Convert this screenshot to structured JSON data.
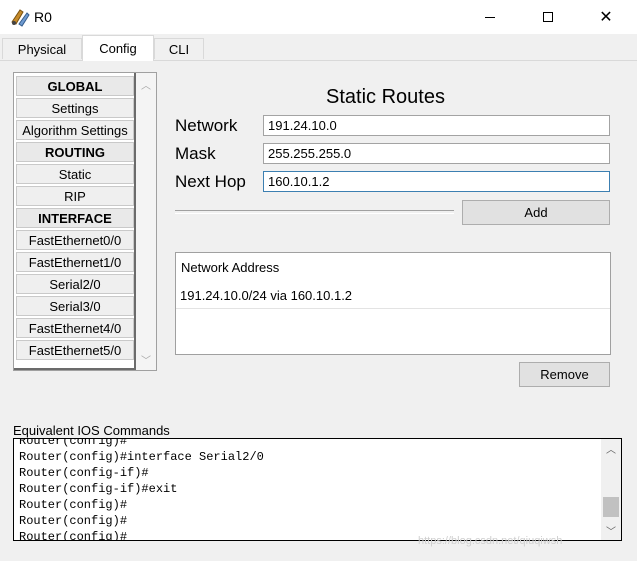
{
  "window": {
    "title": "R0"
  },
  "tabs": [
    {
      "label": "Physical"
    },
    {
      "label": "Config"
    },
    {
      "label": "CLI"
    }
  ],
  "nav": {
    "items": [
      {
        "label": "GLOBAL",
        "header": true
      },
      {
        "label": "Settings",
        "header": false
      },
      {
        "label": "Algorithm Settings",
        "header": false
      },
      {
        "label": "ROUTING",
        "header": true
      },
      {
        "label": "Static",
        "header": false
      },
      {
        "label": "RIP",
        "header": false
      },
      {
        "label": "INTERFACE",
        "header": true
      },
      {
        "label": "FastEthernet0/0",
        "header": false
      },
      {
        "label": "FastEthernet1/0",
        "header": false
      },
      {
        "label": "Serial2/0",
        "header": false
      },
      {
        "label": "Serial3/0",
        "header": false
      },
      {
        "label": "FastEthernet4/0",
        "header": false
      },
      {
        "label": "FastEthernet5/0",
        "header": false
      }
    ]
  },
  "static_routes": {
    "title": "Static Routes",
    "network_label": "Network",
    "network_value": "191.24.10.0",
    "mask_label": "Mask",
    "mask_value": "255.255.255.0",
    "next_hop_label": "Next Hop",
    "next_hop_value": "160.10.1.2",
    "add_label": "Add",
    "table_header": "Network Address",
    "routes": [
      "191.24.10.0/24 via 160.10.1.2"
    ],
    "remove_label": "Remove"
  },
  "ios": {
    "label": "Equivalent IOS Commands",
    "lines": [
      "Router(config)#",
      "Router(config)#interface Serial2/0",
      "Router(config-if)#",
      "Router(config-if)#exit",
      "Router(config)#",
      "Router(config)#",
      "Router(config)#"
    ]
  },
  "watermark": "https://blog.csdn.net/qiuqiwsh"
}
